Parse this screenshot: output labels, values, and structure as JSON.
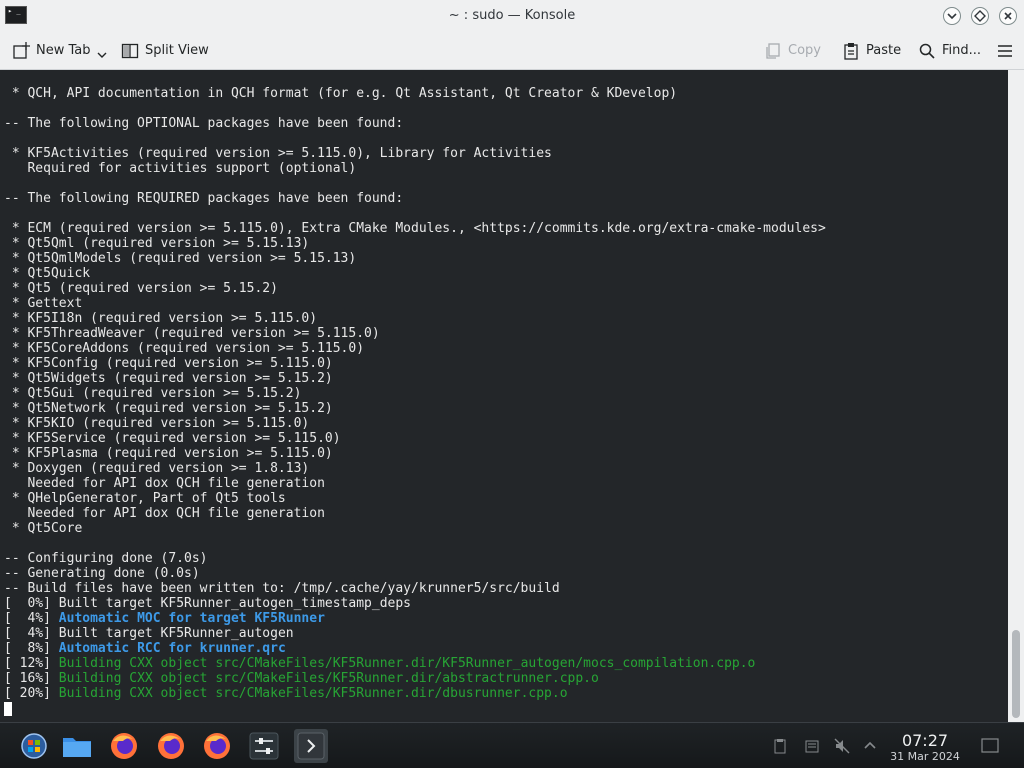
{
  "window": {
    "title": "~ : sudo — Konsole",
    "icon_label": "▸ _"
  },
  "toolbar": {
    "new_tab": "New Tab",
    "split_view": "Split View",
    "copy": "Copy",
    "paste": "Paste",
    "find": "Find..."
  },
  "terminal": {
    "lines": [
      " * QCH, API documentation in QCH format (for e.g. Qt Assistant, Qt Creator & KDevelop)",
      "",
      "-- The following OPTIONAL packages have been found:",
      "",
      " * KF5Activities (required version >= 5.115.0), Library for Activities",
      "   Required for activities support (optional)",
      "",
      "-- The following REQUIRED packages have been found:",
      "",
      " * ECM (required version >= 5.115.0), Extra CMake Modules., <https://commits.kde.org/extra-cmake-modules>",
      " * Qt5Qml (required version >= 5.15.13)",
      " * Qt5QmlModels (required version >= 5.15.13)",
      " * Qt5Quick",
      " * Qt5 (required version >= 5.15.2)",
      " * Gettext",
      " * KF5I18n (required version >= 5.115.0)",
      " * KF5ThreadWeaver (required version >= 5.115.0)",
      " * KF5CoreAddons (required version >= 5.115.0)",
      " * KF5Config (required version >= 5.115.0)",
      " * Qt5Widgets (required version >= 5.15.2)",
      " * Qt5Gui (required version >= 5.15.2)",
      " * Qt5Network (required version >= 5.15.2)",
      " * KF5KIO (required version >= 5.115.0)",
      " * KF5Service (required version >= 5.115.0)",
      " * KF5Plasma (required version >= 5.115.0)",
      " * Doxygen (required version >= 1.8.13)",
      "   Needed for API dox QCH file generation",
      " * QHelpGenerator, Part of Qt5 tools",
      "   Needed for API dox QCH file generation",
      " * Qt5Core",
      "",
      "-- Configuring done (7.0s)",
      "-- Generating done (0.0s)",
      "-- Build files have been written to: /tmp/.cache/yay/krunner5/src/build"
    ],
    "build": [
      {
        "pct": "[  0%] ",
        "text": "Built target KF5Runner_autogen_timestamp_deps",
        "style": "plain"
      },
      {
        "pct": "[  4%] ",
        "text": "Automatic MOC for target KF5Runner",
        "style": "moc"
      },
      {
        "pct": "[  4%] ",
        "text": "Built target KF5Runner_autogen",
        "style": "plain"
      },
      {
        "pct": "[  8%] ",
        "text": "Automatic RCC for krunner.qrc",
        "style": "moc"
      },
      {
        "pct": "[ 12%] ",
        "text": "Building CXX object src/CMakeFiles/KF5Runner.dir/KF5Runner_autogen/mocs_compilation.cpp.o",
        "style": "green"
      },
      {
        "pct": "[ 16%] ",
        "text": "Building CXX object src/CMakeFiles/KF5Runner.dir/abstractrunner.cpp.o",
        "style": "green"
      },
      {
        "pct": "[ 20%] ",
        "text": "Building CXX object src/CMakeFiles/KF5Runner.dir/dbusrunner.cpp.o",
        "style": "green"
      }
    ]
  },
  "taskbar": {
    "apps": [
      "start-menu-icon",
      "file-manager-icon",
      "firefox-icon",
      "firefox-icon",
      "firefox-icon",
      "settings-icon",
      "konsole-icon"
    ],
    "time": "07:27",
    "date": "31 Mar 2024"
  },
  "colors": {
    "terminal_bg": "#232629",
    "moc_blue": "#3d9ae8",
    "build_green": "#27a535"
  }
}
